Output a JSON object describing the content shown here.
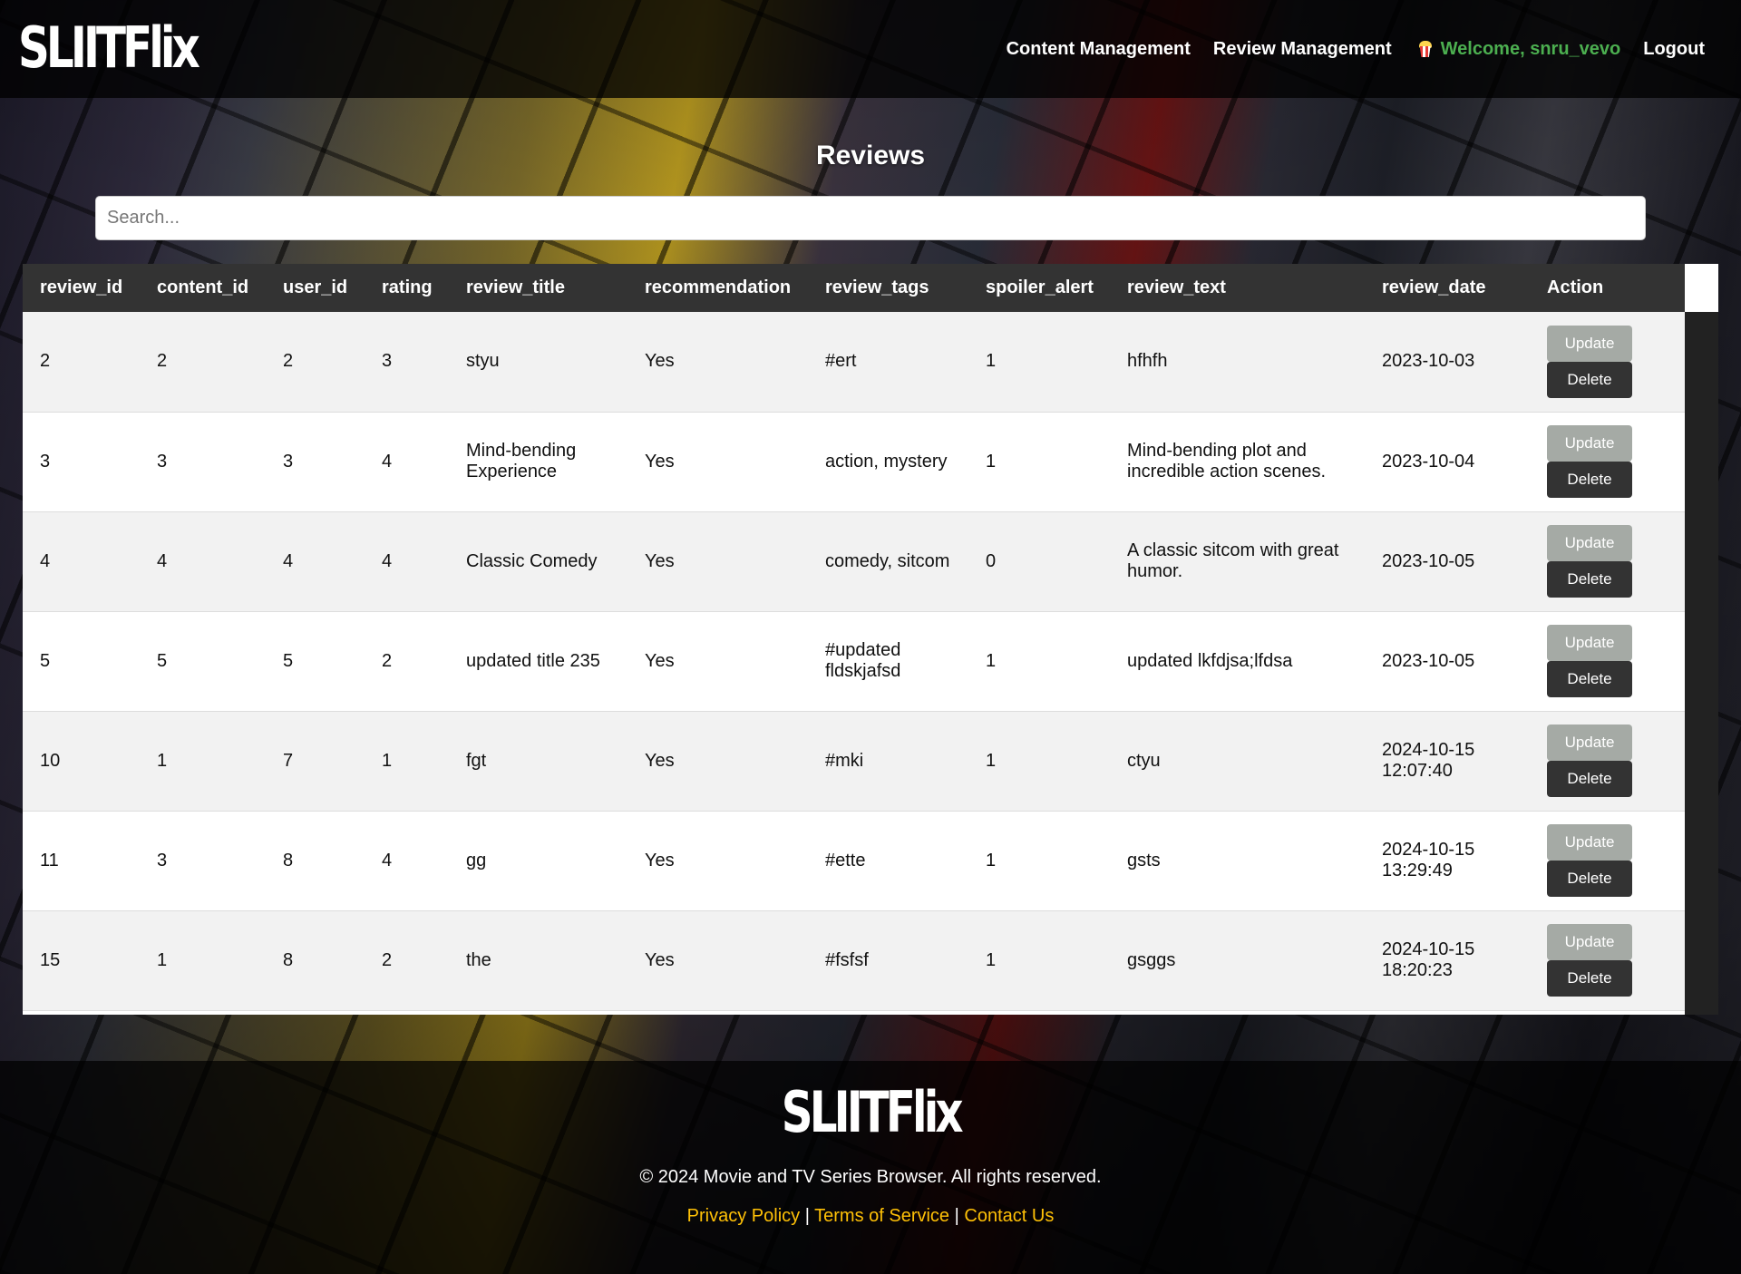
{
  "header": {
    "logo": "SLIITFlix",
    "nav": {
      "content_management": "Content Management",
      "review_management": "Review Management",
      "welcome": "Welcome, snru_vevo",
      "logout": "Logout"
    },
    "welcome_icon": "popcorn-icon",
    "welcome_color": "#4caf50"
  },
  "main": {
    "title": "Reviews",
    "search": {
      "placeholder": "Search...",
      "value": ""
    },
    "table": {
      "columns": [
        "review_id",
        "content_id",
        "user_id",
        "rating",
        "review_title",
        "recommendation",
        "review_tags",
        "spoiler_alert",
        "review_text",
        "review_date",
        "Action"
      ],
      "update_label": "Update",
      "delete_label": "Delete",
      "rows": [
        [
          "2",
          "2",
          "2",
          "3",
          "styu",
          "Yes",
          "#ert",
          "1",
          "hfhfh",
          "2023-10-03"
        ],
        [
          "3",
          "3",
          "3",
          "4",
          "Mind-bending Experience",
          "Yes",
          "action, mystery",
          "1",
          "Mind-bending plot and incredible action scenes.",
          "2023-10-04"
        ],
        [
          "4",
          "4",
          "4",
          "4",
          "Classic Comedy",
          "Yes",
          "comedy, sitcom",
          "0",
          "A classic sitcom with great humor.",
          "2023-10-05"
        ],
        [
          "5",
          "5",
          "5",
          "2",
          "updated title 235",
          "Yes",
          "#updated fldskjafsd",
          "1",
          "updated lkfdjsa;lfdsa",
          "2023-10-05"
        ],
        [
          "10",
          "1",
          "7",
          "1",
          "fgt",
          "Yes",
          "#mki",
          "1",
          "ctyu",
          "2024-10-15 12:07:40"
        ],
        [
          "11",
          "3",
          "8",
          "4",
          "gg",
          "Yes",
          "#ette",
          "1",
          "gsts",
          "2024-10-15 13:29:49"
        ],
        [
          "15",
          "1",
          "8",
          "2",
          "the",
          "Yes",
          "#fsfsf",
          "1",
          "gsggs",
          "2024-10-15 18:20:23"
        ]
      ]
    }
  },
  "footer": {
    "logo": "SLIITFlix",
    "copyright": "© 2024 Movie and TV Series Browser. All rights reserved.",
    "links": {
      "privacy": "Privacy Policy",
      "separator": "|",
      "terms": "Terms of Service",
      "contact": "Contact Us"
    },
    "link_color": "#ffc107"
  }
}
